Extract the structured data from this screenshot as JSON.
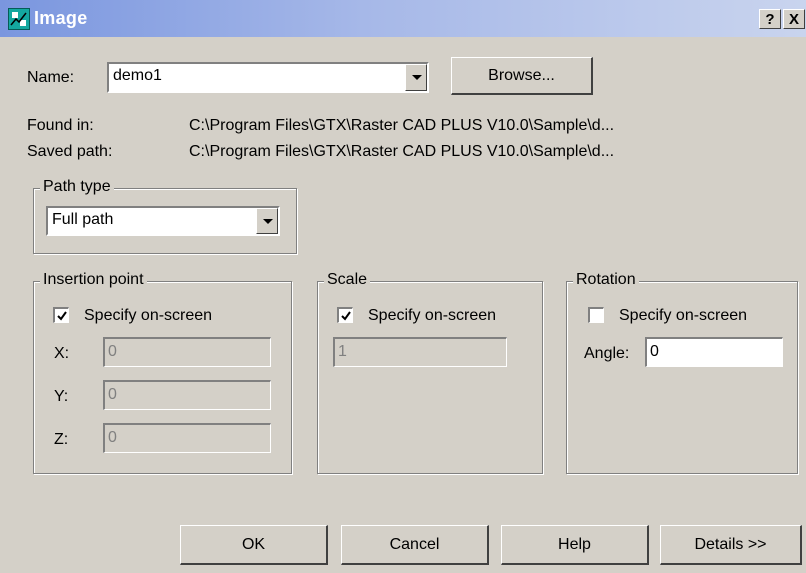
{
  "window": {
    "title": "Image",
    "help_button": "?",
    "close_button": "X"
  },
  "name_row": {
    "label": "Name:",
    "value": "demo1",
    "browse_label": "Browse..."
  },
  "found_in": {
    "label": "Found in:",
    "value": "C:\\Program Files\\GTX\\Raster CAD PLUS V10.0\\Sample\\d..."
  },
  "saved_path": {
    "label": "Saved path:",
    "value": "C:\\Program Files\\GTX\\Raster CAD PLUS V10.0\\Sample\\d..."
  },
  "path_type": {
    "title": "Path type",
    "selected": "Full path"
  },
  "insertion_point": {
    "title": "Insertion point",
    "specify_label": "Specify on-screen",
    "specify_checked": true,
    "x_label": "X:",
    "x_value": "0",
    "y_label": "Y:",
    "y_value": "0",
    "z_label": "Z:",
    "z_value": "0"
  },
  "scale": {
    "title": "Scale",
    "specify_label": "Specify on-screen",
    "specify_checked": true,
    "value": "1"
  },
  "rotation": {
    "title": "Rotation",
    "specify_label": "Specify on-screen",
    "specify_checked": false,
    "angle_label": "Angle:",
    "angle_value": "0"
  },
  "buttons": {
    "ok": "OK",
    "cancel": "Cancel",
    "help": "Help",
    "details": "Details >>"
  },
  "colors": {
    "face": "#d4d0c8",
    "titlebar_start": "#7a96df",
    "titlebar_end": "#c9d4ee",
    "disabled_text": "#808080"
  },
  "icons": [
    "image-app-icon",
    "help-icon",
    "close-icon",
    "dropdown-arrow-icon",
    "checkmark-icon"
  ]
}
